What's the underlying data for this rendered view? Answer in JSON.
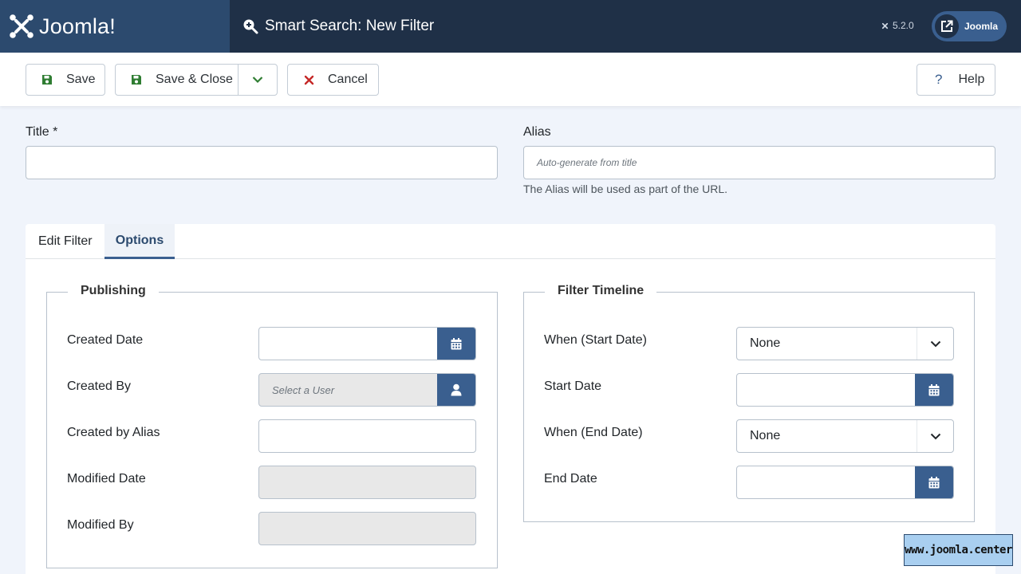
{
  "header": {
    "brand": "Joomla!",
    "page_title": "Smart Search: New Filter",
    "version": "5.2.0",
    "user_menu_label": "Joomla"
  },
  "toolbar": {
    "save_label": "Save",
    "save_close_label": "Save & Close",
    "cancel_label": "Cancel",
    "help_label": "Help"
  },
  "form": {
    "title_label": "Title *",
    "title_value": "",
    "alias_label": "Alias",
    "alias_placeholder": "Auto-generate from title",
    "alias_hint": "The Alias will be used as part of the URL."
  },
  "tabs": [
    {
      "label": "Edit Filter",
      "active": false
    },
    {
      "label": "Options",
      "active": true
    }
  ],
  "publishing": {
    "legend": "Publishing",
    "created_date_label": "Created Date",
    "created_by_label": "Created By",
    "created_by_placeholder": "Select a User",
    "created_by_alias_label": "Created by Alias",
    "modified_date_label": "Modified Date",
    "modified_by_label": "Modified By"
  },
  "timeline": {
    "legend": "Filter Timeline",
    "when_start_label": "When (Start Date)",
    "when_start_value": "None",
    "start_date_label": "Start Date",
    "when_end_label": "When (End Date)",
    "when_end_value": "None",
    "end_date_label": "End Date"
  },
  "watermark": "www.joomla.center",
  "colors": {
    "header_bg": "#1f3047",
    "logo_bg": "#2c4a6e",
    "accent": "#3a5f8f",
    "save_icon": "#2f7d32",
    "cancel_icon": "#c52827"
  },
  "icons": {
    "search": "search-plus-icon",
    "save": "floppy-disk-icon",
    "cancel": "x-icon",
    "help": "question-icon",
    "calendar": "calendar-icon",
    "user": "user-icon",
    "external": "external-link-icon"
  }
}
